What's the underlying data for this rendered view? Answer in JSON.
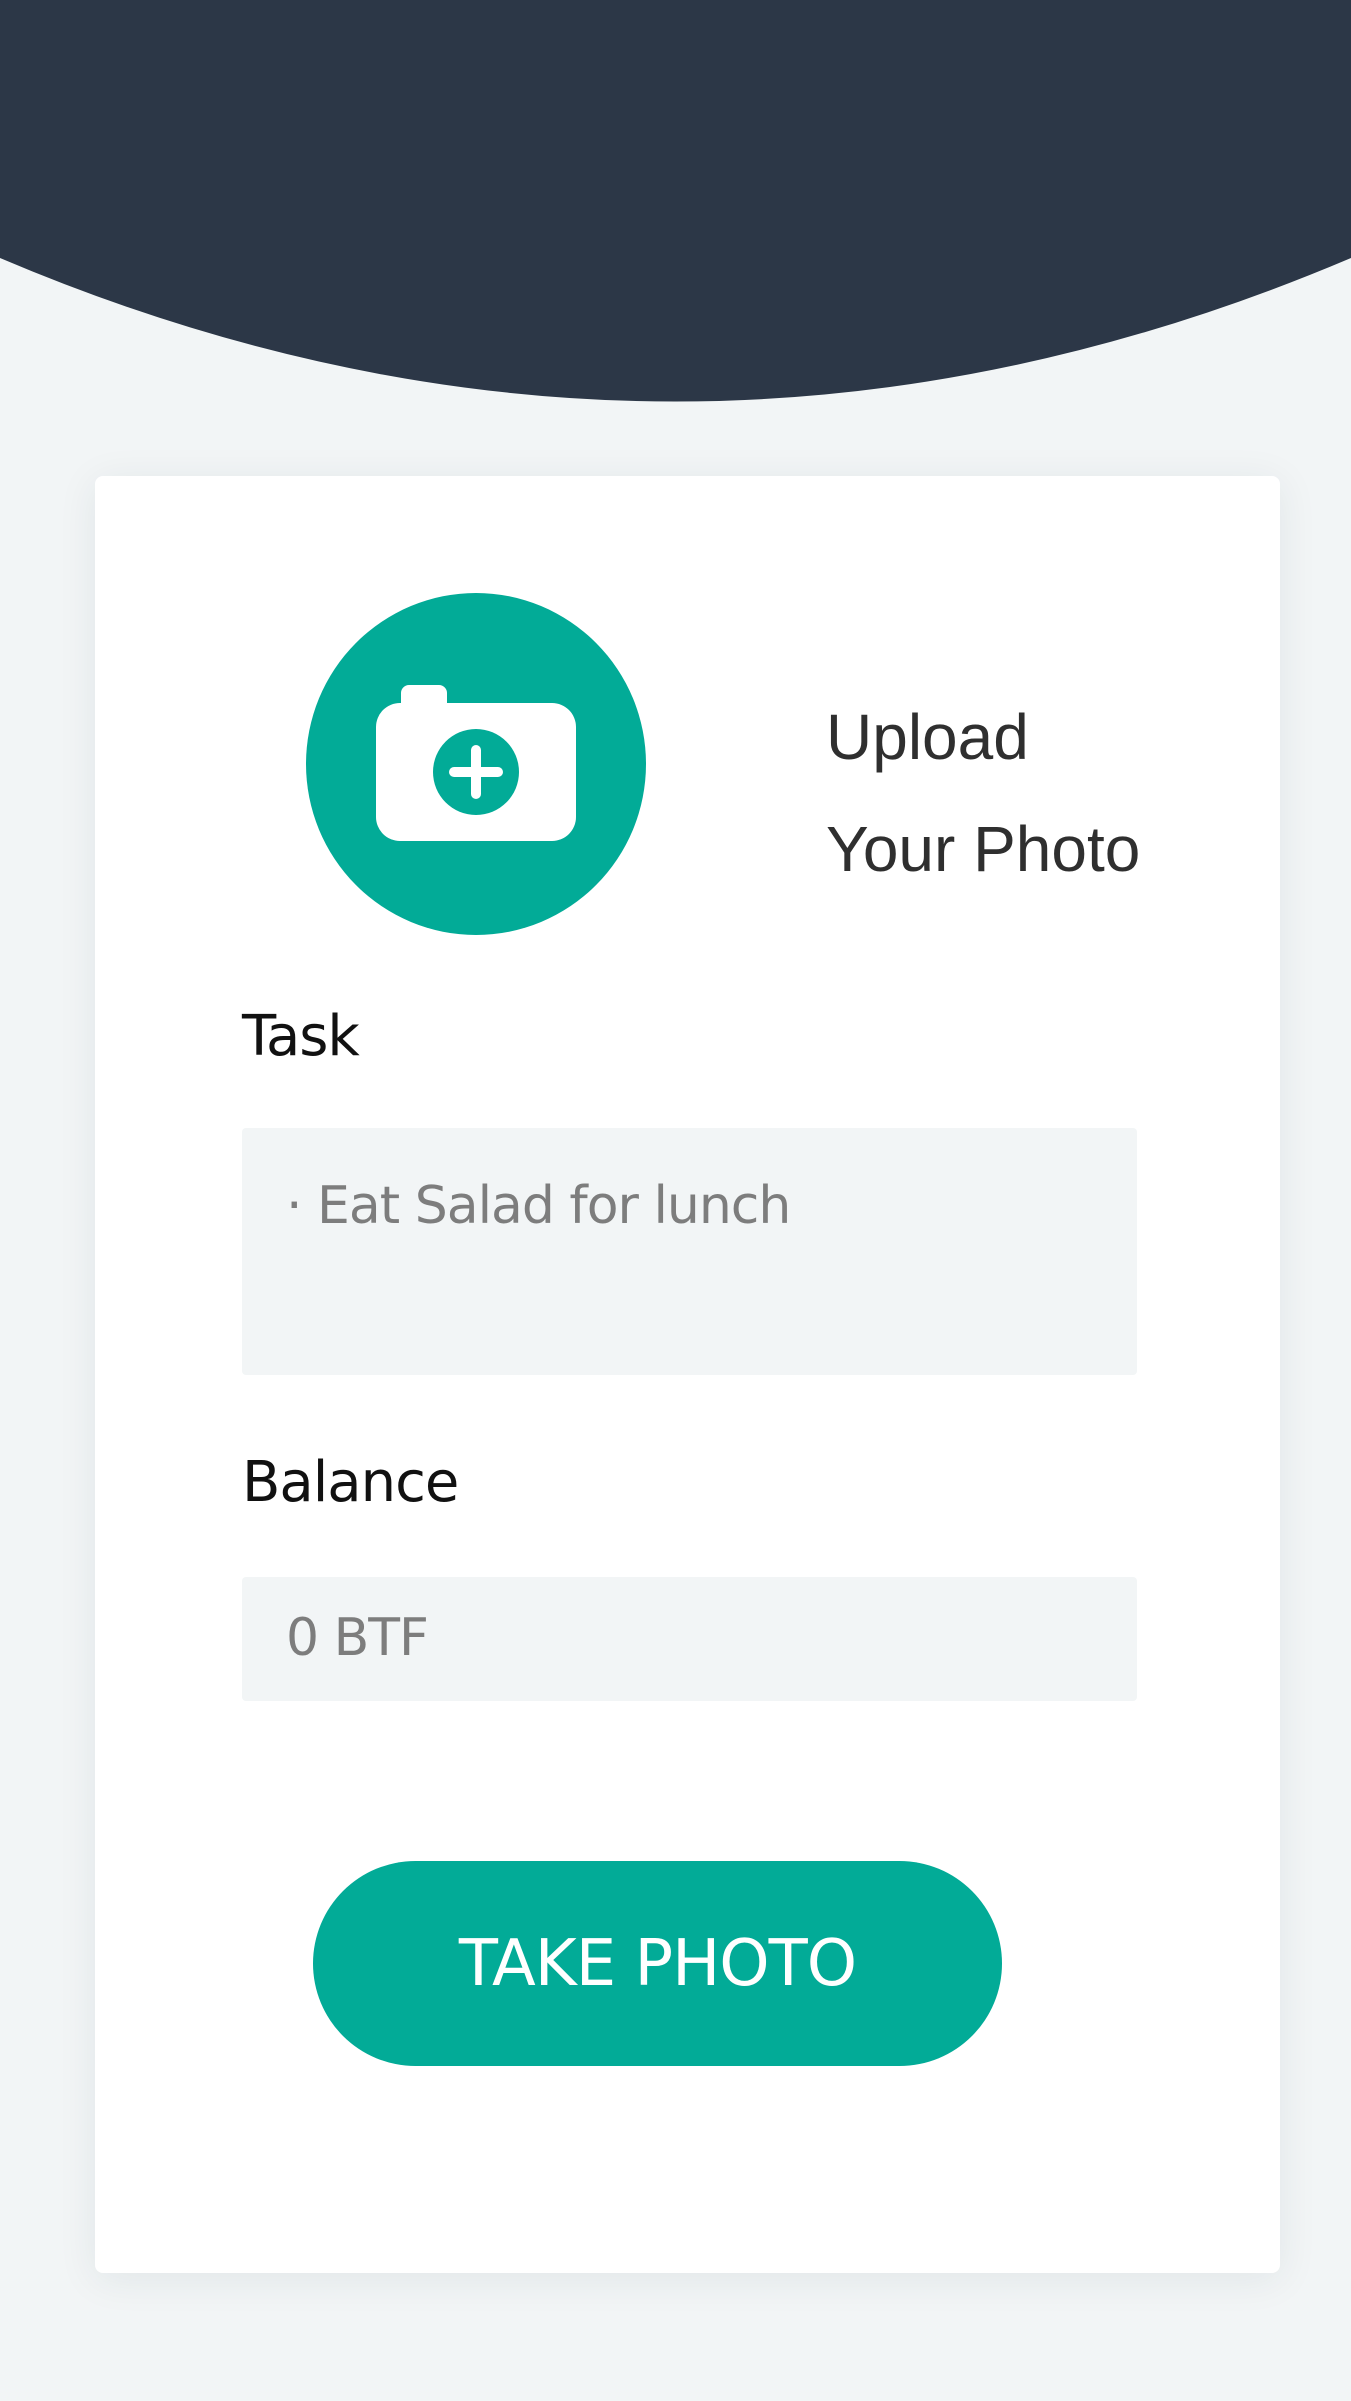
{
  "colors": {
    "header": "#2c3747",
    "accent": "#02ab97",
    "background": "#f2f5f6",
    "card": "#ffffff",
    "field_background": "#f2f5f6",
    "field_text": "#7d7d7d"
  },
  "upload": {
    "icon": "camera-plus-icon",
    "line1": "Upload",
    "line2": "Your Photo"
  },
  "task": {
    "label": "Task",
    "value": "· Eat Salad for lunch"
  },
  "balance": {
    "label": "Balance",
    "value": "0 BTF"
  },
  "actions": {
    "take_photo_label": "TAKE PHOTO"
  }
}
